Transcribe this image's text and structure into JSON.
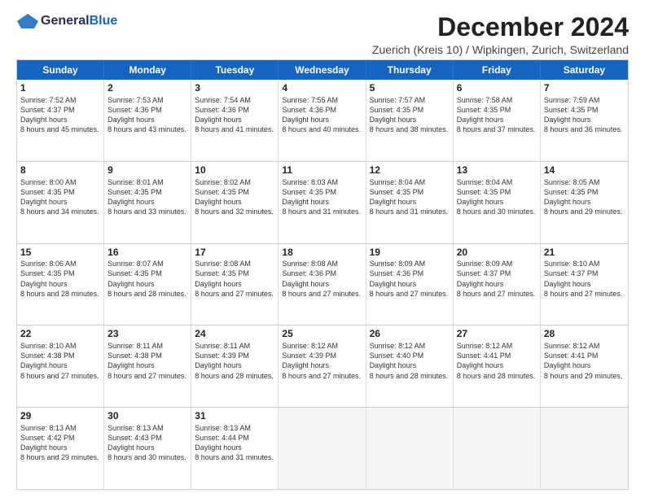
{
  "logo": {
    "general": "General",
    "blue": "Blue"
  },
  "title": "December 2024",
  "subtitle": "Zuerich (Kreis 10) / Wipkingen, Zurich, Switzerland",
  "days_of_week": [
    "Sunday",
    "Monday",
    "Tuesday",
    "Wednesday",
    "Thursday",
    "Friday",
    "Saturday"
  ],
  "weeks": [
    [
      {
        "day": "1",
        "sunrise": "7:52 AM",
        "sunset": "4:37 PM",
        "daylight": "8 hours and 45 minutes."
      },
      {
        "day": "2",
        "sunrise": "7:53 AM",
        "sunset": "4:36 PM",
        "daylight": "8 hours and 43 minutes."
      },
      {
        "day": "3",
        "sunrise": "7:54 AM",
        "sunset": "4:36 PM",
        "daylight": "8 hours and 41 minutes."
      },
      {
        "day": "4",
        "sunrise": "7:55 AM",
        "sunset": "4:36 PM",
        "daylight": "8 hours and 40 minutes."
      },
      {
        "day": "5",
        "sunrise": "7:57 AM",
        "sunset": "4:35 PM",
        "daylight": "8 hours and 38 minutes."
      },
      {
        "day": "6",
        "sunrise": "7:58 AM",
        "sunset": "4:35 PM",
        "daylight": "8 hours and 37 minutes."
      },
      {
        "day": "7",
        "sunrise": "7:59 AM",
        "sunset": "4:35 PM",
        "daylight": "8 hours and 36 minutes."
      }
    ],
    [
      {
        "day": "8",
        "sunrise": "8:00 AM",
        "sunset": "4:35 PM",
        "daylight": "8 hours and 34 minutes."
      },
      {
        "day": "9",
        "sunrise": "8:01 AM",
        "sunset": "4:35 PM",
        "daylight": "8 hours and 33 minutes."
      },
      {
        "day": "10",
        "sunrise": "8:02 AM",
        "sunset": "4:35 PM",
        "daylight": "8 hours and 32 minutes."
      },
      {
        "day": "11",
        "sunrise": "8:03 AM",
        "sunset": "4:35 PM",
        "daylight": "8 hours and 31 minutes."
      },
      {
        "day": "12",
        "sunrise": "8:04 AM",
        "sunset": "4:35 PM",
        "daylight": "8 hours and 31 minutes."
      },
      {
        "day": "13",
        "sunrise": "8:04 AM",
        "sunset": "4:35 PM",
        "daylight": "8 hours and 30 minutes."
      },
      {
        "day": "14",
        "sunrise": "8:05 AM",
        "sunset": "4:35 PM",
        "daylight": "8 hours and 29 minutes."
      }
    ],
    [
      {
        "day": "15",
        "sunrise": "8:06 AM",
        "sunset": "4:35 PM",
        "daylight": "8 hours and 28 minutes."
      },
      {
        "day": "16",
        "sunrise": "8:07 AM",
        "sunset": "4:35 PM",
        "daylight": "8 hours and 28 minutes."
      },
      {
        "day": "17",
        "sunrise": "8:08 AM",
        "sunset": "4:35 PM",
        "daylight": "8 hours and 27 minutes."
      },
      {
        "day": "18",
        "sunrise": "8:08 AM",
        "sunset": "4:36 PM",
        "daylight": "8 hours and 27 minutes."
      },
      {
        "day": "19",
        "sunrise": "8:09 AM",
        "sunset": "4:36 PM",
        "daylight": "8 hours and 27 minutes."
      },
      {
        "day": "20",
        "sunrise": "8:09 AM",
        "sunset": "4:37 PM",
        "daylight": "8 hours and 27 minutes."
      },
      {
        "day": "21",
        "sunrise": "8:10 AM",
        "sunset": "4:37 PM",
        "daylight": "8 hours and 27 minutes."
      }
    ],
    [
      {
        "day": "22",
        "sunrise": "8:10 AM",
        "sunset": "4:38 PM",
        "daylight": "8 hours and 27 minutes."
      },
      {
        "day": "23",
        "sunrise": "8:11 AM",
        "sunset": "4:38 PM",
        "daylight": "8 hours and 27 minutes."
      },
      {
        "day": "24",
        "sunrise": "8:11 AM",
        "sunset": "4:39 PM",
        "daylight": "8 hours and 28 minutes."
      },
      {
        "day": "25",
        "sunrise": "8:12 AM",
        "sunset": "4:39 PM",
        "daylight": "8 hours and 27 minutes."
      },
      {
        "day": "26",
        "sunrise": "8:12 AM",
        "sunset": "4:40 PM",
        "daylight": "8 hours and 28 minutes."
      },
      {
        "day": "27",
        "sunrise": "8:12 AM",
        "sunset": "4:41 PM",
        "daylight": "8 hours and 28 minutes."
      },
      {
        "day": "28",
        "sunrise": "8:12 AM",
        "sunset": "4:41 PM",
        "daylight": "8 hours and 29 minutes."
      }
    ],
    [
      {
        "day": "29",
        "sunrise": "8:13 AM",
        "sunset": "4:42 PM",
        "daylight": "8 hours and 29 minutes."
      },
      {
        "day": "30",
        "sunrise": "8:13 AM",
        "sunset": "4:43 PM",
        "daylight": "8 hours and 30 minutes."
      },
      {
        "day": "31",
        "sunrise": "8:13 AM",
        "sunset": "4:44 PM",
        "daylight": "8 hours and 31 minutes."
      },
      null,
      null,
      null,
      null
    ]
  ]
}
